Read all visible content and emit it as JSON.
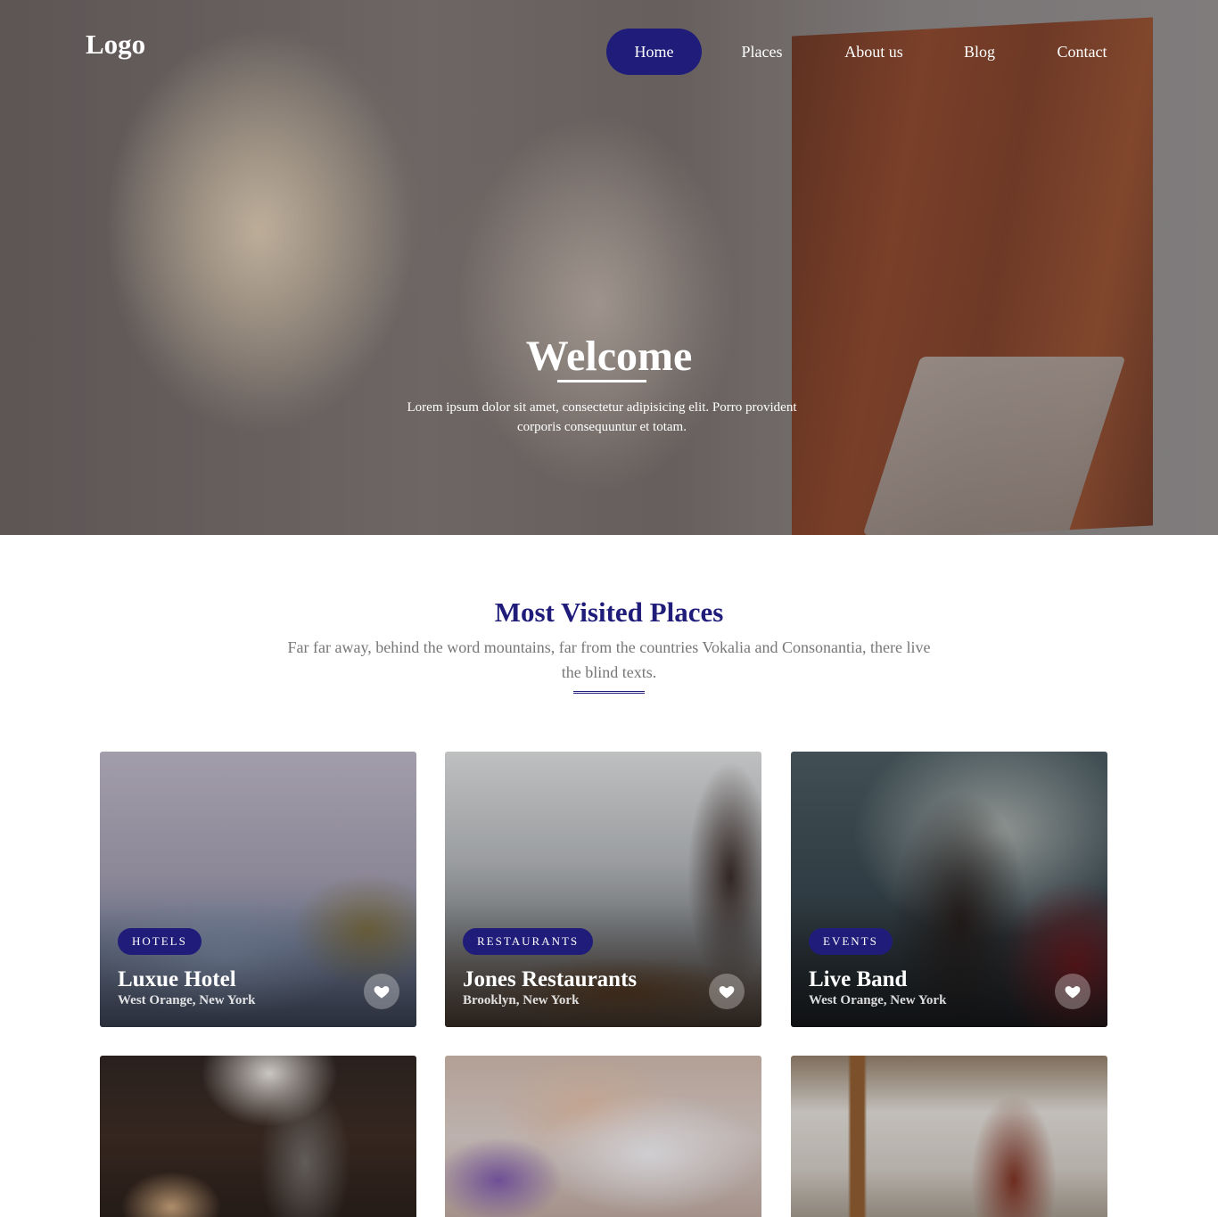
{
  "header": {
    "logo": "Logo",
    "nav": [
      {
        "label": "Home",
        "active": true
      },
      {
        "label": "Places",
        "active": false
      },
      {
        "label": "About us",
        "active": false
      },
      {
        "label": "Blog",
        "active": false
      },
      {
        "label": "Contact",
        "active": false
      }
    ]
  },
  "hero": {
    "title": "Welcome",
    "text": "Lorem ipsum dolor sit amet, consectetur adipisicing elit. Porro provident corporis consequuntur et totam."
  },
  "places": {
    "title": "Most Visited Places",
    "subtitle": "Far far away, behind the word mountains, far from the countries Vokalia and Consonantia, there live the blind texts.",
    "cards": [
      {
        "category": "HOTELS",
        "title": "Luxue Hotel",
        "location": "West Orange, New York"
      },
      {
        "category": "RESTAURANTS",
        "title": "Jones Restaurants",
        "location": "Brooklyn, New York"
      },
      {
        "category": "EVENTS",
        "title": "Live Band",
        "location": "West Orange, New York"
      }
    ]
  },
  "colors": {
    "accent": "#1f1c7a",
    "muted_text": "#777777"
  },
  "icons": {
    "favorite": "heart-icon"
  }
}
